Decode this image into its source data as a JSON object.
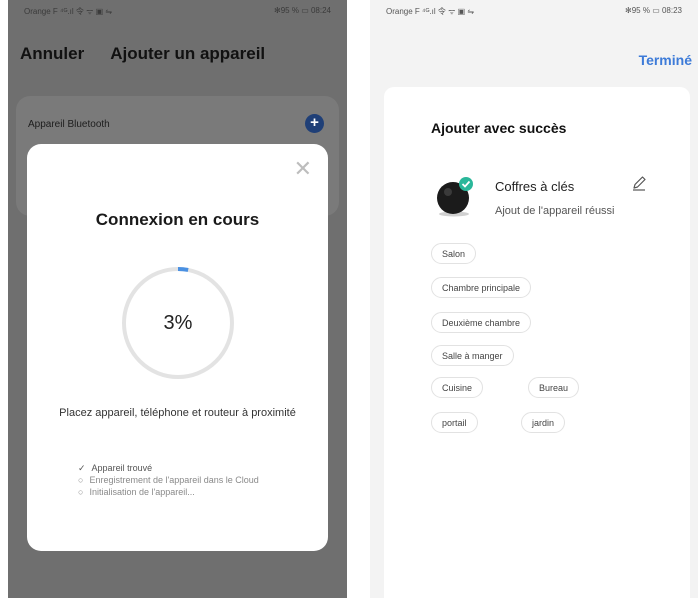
{
  "left": {
    "status": {
      "carrier": "Orange F ⁴ᴳ.ıl 令 ᯤ ▣ ⇋",
      "right": "✻95 % ▭ 08:24"
    },
    "header": {
      "cancel": "Annuler",
      "title": "Ajouter un appareil"
    },
    "bluetooth_row": "Appareil Bluetooth",
    "plus_icon": "+",
    "dialog": {
      "close": "✕",
      "title": "Connexion en cours",
      "progress_percent": 3,
      "progress_label": "3%",
      "hint": "Placez appareil, téléphone et routeur à proximité",
      "steps": [
        {
          "icon": "✓",
          "text": "Appareil trouvé"
        },
        {
          "icon": "○",
          "text": "Enregistrement de l'appareil dans le Cloud"
        },
        {
          "icon": "○",
          "text": "Initialisation de l'appareil..."
        }
      ]
    }
  },
  "right": {
    "status": {
      "carrier": "Orange F ⁴ᴳ.ıl 令 ᯤ ▣ ⇋",
      "right": "✻95 % ▭ 08:23"
    },
    "done": "Terminé",
    "card": {
      "title": "Ajouter avec succès",
      "device_name": "Coffres à clés",
      "device_status": "Ajout de l'appareil réussi",
      "rooms": [
        "Salon",
        "Chambre principale",
        "Deuxième chambre",
        "Salle à manger",
        "Cuisine",
        "Bureau",
        "portail",
        "jardin"
      ]
    }
  },
  "colors": {
    "accent": "#3d7bd8",
    "success": "#2ab79a",
    "progress": "#4a90e2"
  },
  "icons": [
    "plus-icon",
    "close-icon",
    "check-icon",
    "circle-icon",
    "edit-pencil-icon",
    "device-image"
  ]
}
